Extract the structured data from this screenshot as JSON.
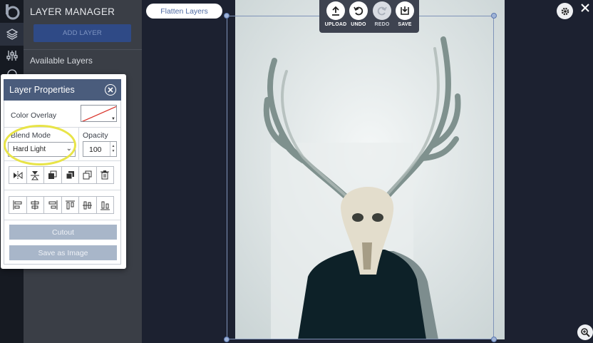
{
  "panel": {
    "title": "LAYER MANAGER",
    "add_layer_label": "ADD LAYER",
    "available_label": "Available Layers"
  },
  "top": {
    "flatten_label": "Flatten Layers",
    "actions": [
      {
        "label": "UPLOAD",
        "icon": "upload-icon",
        "enabled": true
      },
      {
        "label": "UNDO",
        "icon": "undo-icon",
        "enabled": true
      },
      {
        "label": "REDO",
        "icon": "redo-icon",
        "enabled": false
      },
      {
        "label": "SAVE",
        "icon": "save-icon",
        "enabled": true
      }
    ]
  },
  "props": {
    "title": "Layer Properties",
    "color_overlay_label": "Color Overlay",
    "blend_mode_label": "Blend Mode",
    "blend_mode_value": "Hard Light",
    "opacity_label": "Opacity",
    "opacity_value": "100",
    "transform_tools": [
      "flip-horizontal-icon",
      "flip-vertical-icon",
      "bring-forward-icon",
      "send-backward-icon",
      "duplicate-icon",
      "trash-icon"
    ],
    "align_tools": [
      "align-left-icon",
      "align-center-horizontal-icon",
      "align-right-icon",
      "align-top-icon",
      "align-middle-icon",
      "align-bottom-icon"
    ],
    "cutout_label": "Cutout",
    "save_image_label": "Save as Image"
  },
  "colors": {
    "accent": "#2f4a86",
    "header": "#4a5c7c",
    "highlight": "#e8e448"
  }
}
